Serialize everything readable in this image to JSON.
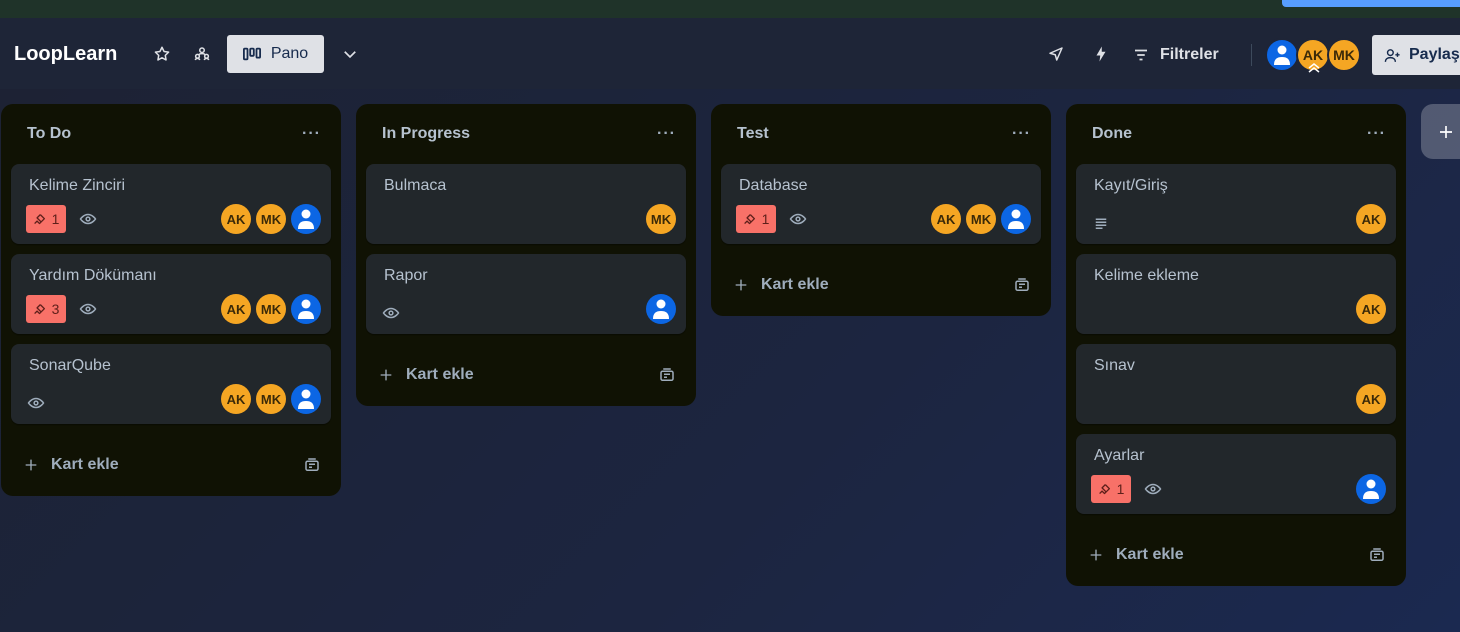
{
  "header": {
    "board_name": "LoopLearn",
    "view_label": "Pano",
    "filter_label": "Filtreler",
    "share_label": "Paylaş",
    "members": [
      "",
      "AK",
      "MK"
    ]
  },
  "colors": {
    "avatar_orange": "#f5a623",
    "avatar_blue": "#0c66e4",
    "label_red": "#f87168",
    "list_bg": "#101204",
    "card_bg": "#22272b"
  },
  "lists": [
    {
      "title": "To Do",
      "add_label": "Kart ekle",
      "cards": [
        {
          "title": "Kelime Zinciri",
          "label_count": "1",
          "watch": true,
          "avatars": [
            "AK",
            "MK",
            ""
          ]
        },
        {
          "title": "Yardım Dökümanı",
          "label_count": "3",
          "watch": true,
          "avatars": [
            "AK",
            "MK",
            ""
          ]
        },
        {
          "title": "SonarQube",
          "label_count": null,
          "watch": true,
          "avatars": [
            "AK",
            "MK",
            ""
          ]
        }
      ]
    },
    {
      "title": "In Progress",
      "add_label": "Kart ekle",
      "cards": [
        {
          "title": "Bulmaca",
          "label_count": null,
          "watch": false,
          "avatars": [
            "MK"
          ]
        },
        {
          "title": "Rapor",
          "label_count": null,
          "watch": true,
          "avatars": [
            ""
          ]
        }
      ]
    },
    {
      "title": "Test",
      "add_label": "Kart ekle",
      "cards": [
        {
          "title": "Database",
          "label_count": "1",
          "watch": true,
          "avatars": [
            "AK",
            "MK",
            ""
          ]
        }
      ]
    },
    {
      "title": "Done",
      "add_label": "Kart ekle",
      "cards": [
        {
          "title": "Kayıt/Giriş",
          "label_count": null,
          "watch": false,
          "description": true,
          "avatars": [
            "AK"
          ]
        },
        {
          "title": "Kelime ekleme",
          "label_count": null,
          "watch": false,
          "avatars": [
            "AK"
          ]
        },
        {
          "title": "Sınav",
          "label_count": null,
          "watch": false,
          "avatars": [
            "AK"
          ]
        },
        {
          "title": "Ayarlar",
          "label_count": "1",
          "watch": true,
          "avatars": [
            ""
          ]
        }
      ]
    }
  ]
}
